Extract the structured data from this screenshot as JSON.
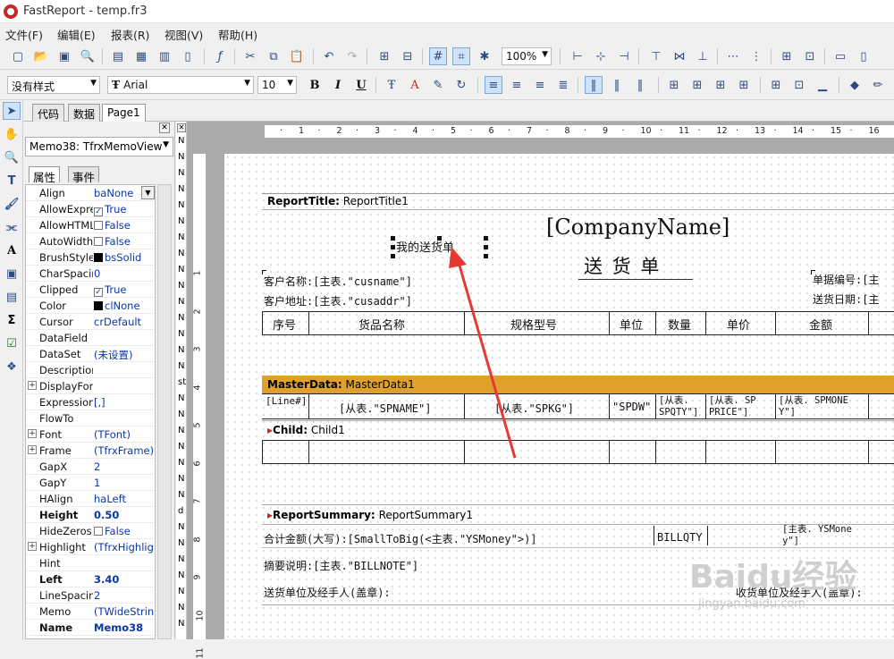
{
  "app": {
    "title": "FastReport - temp.fr3"
  },
  "menu": [
    "文件(F)",
    "编辑(E)",
    "报表(R)",
    "视图(V)",
    "帮助(H)"
  ],
  "toolbar": {
    "zoom": "100%",
    "style": "没有样式",
    "font": "Arial",
    "size": "10",
    "bold": "B",
    "italic": "I",
    "underline": "U"
  },
  "tabs": [
    "代码",
    "数据",
    "Page1"
  ],
  "object_selector": "Memo38: TfrxMemoView",
  "property_tabs": [
    "属性",
    "事件"
  ],
  "properties": [
    {
      "name": "Align",
      "value": "baNone",
      "type": "dd"
    },
    {
      "name": "AllowExpre",
      "value": "True",
      "type": "check",
      "checked": true
    },
    {
      "name": "AllowHTML",
      "value": "False",
      "type": "check",
      "checked": false
    },
    {
      "name": "AutoWidth",
      "value": "False",
      "type": "check",
      "checked": false
    },
    {
      "name": "BrushStyle",
      "value": "bsSolid",
      "type": "swatch"
    },
    {
      "name": "CharSpacir",
      "value": "0"
    },
    {
      "name": "Clipped",
      "value": "True",
      "type": "check",
      "checked": true
    },
    {
      "name": "Color",
      "value": "clNone",
      "type": "swatch"
    },
    {
      "name": "Cursor",
      "value": "crDefault"
    },
    {
      "name": "DataField",
      "value": ""
    },
    {
      "name": "DataSet",
      "value": "(未设置)"
    },
    {
      "name": "Description",
      "value": ""
    },
    {
      "name": "DisplayForr",
      "value": "",
      "exp": true
    },
    {
      "name": "Expression",
      "value": "[,]"
    },
    {
      "name": "FlowTo",
      "value": ""
    },
    {
      "name": "Font",
      "value": "(TFont)",
      "exp": true
    },
    {
      "name": "Frame",
      "value": "(TfrxFrame)",
      "exp": true
    },
    {
      "name": "GapX",
      "value": "2"
    },
    {
      "name": "GapY",
      "value": "1"
    },
    {
      "name": "HAlign",
      "value": "haLeft"
    },
    {
      "name": "Height",
      "value": "0.50",
      "bold": true
    },
    {
      "name": "HideZeros",
      "value": "False",
      "type": "check",
      "checked": false
    },
    {
      "name": "Highlight",
      "value": "(TfrxHighlig",
      "exp": true
    },
    {
      "name": "Hint",
      "value": ""
    },
    {
      "name": "Left",
      "value": "3.40",
      "bold": true
    },
    {
      "name": "LineSpacing",
      "value": "2"
    },
    {
      "name": "Memo",
      "value": "(TWideStrin"
    },
    {
      "name": "Name",
      "value": "Memo38",
      "bold": true
    }
  ],
  "strip_chars": [
    "N",
    "N",
    "N",
    "N",
    "N",
    "N",
    "N",
    "N",
    "N",
    "N",
    "N",
    "N",
    "N",
    "N",
    "N",
    "st",
    "N",
    "N",
    "N",
    "N",
    "N",
    "N",
    "N",
    "d",
    "N",
    "N",
    "N",
    "N",
    "N",
    "N",
    "N"
  ],
  "ruler_h": [
    "1",
    "2",
    "3",
    "4",
    "5",
    "6",
    "7",
    "8",
    "9",
    "10",
    "11",
    "12",
    "13",
    "14",
    "15",
    "16"
  ],
  "ruler_v": [
    "1",
    "2",
    "3",
    "4",
    "5",
    "6",
    "7",
    "8",
    "9",
    "10",
    "11"
  ],
  "report": {
    "title_band": {
      "kind": "ReportTitle:",
      "name": "ReportTitle1"
    },
    "company": "[CompanyName]",
    "doc_title": "送 货 单",
    "my_delivery": "我的送货单",
    "customer_name": "客户名称:[主表.\"cusname\"]",
    "customer_addr": "客户地址:[主表.\"cusaddr\"]",
    "bill_no": "单据编号:[主",
    "ship_date": "送货日期:[主",
    "headers": [
      "序号",
      "货品名称",
      "规格型号",
      "单位",
      "数量",
      "单价",
      "金额"
    ],
    "master_band": {
      "kind": "MasterData:",
      "name": "MasterData1"
    },
    "master_cells": [
      "[Line#]",
      "[从表.\"SPNAME\"]",
      "[从表.\"SPKG\"]",
      "\"SPDW\"",
      "[从表. SPQTY\"]",
      "[从表. SP PRICE\"]",
      "[从表. SPMONE Y\"]"
    ],
    "child_band": {
      "kind": "Child:",
      "name": "Child1"
    },
    "summary_band": {
      "kind": "ReportSummary:",
      "name": "ReportSummary1"
    },
    "total_words": "合计金额(大写):[SmallToBig(<主表.\"YSMoney\">)]",
    "billqty": "BILLQTY",
    "ysmoney": "[主表. YSMone y\"]",
    "remark": "摘要说明:[主表.\"BILLNOTE\"]",
    "sender": "送货单位及经手人(盖章):",
    "receiver": "收货单位及经手人(盖章):"
  },
  "watermark": {
    "main": "Baidu经验",
    "sub": "jingyan.baidu.com"
  },
  "colors": {
    "master_band": "#e0a12c",
    "arrow": "#e53935"
  }
}
